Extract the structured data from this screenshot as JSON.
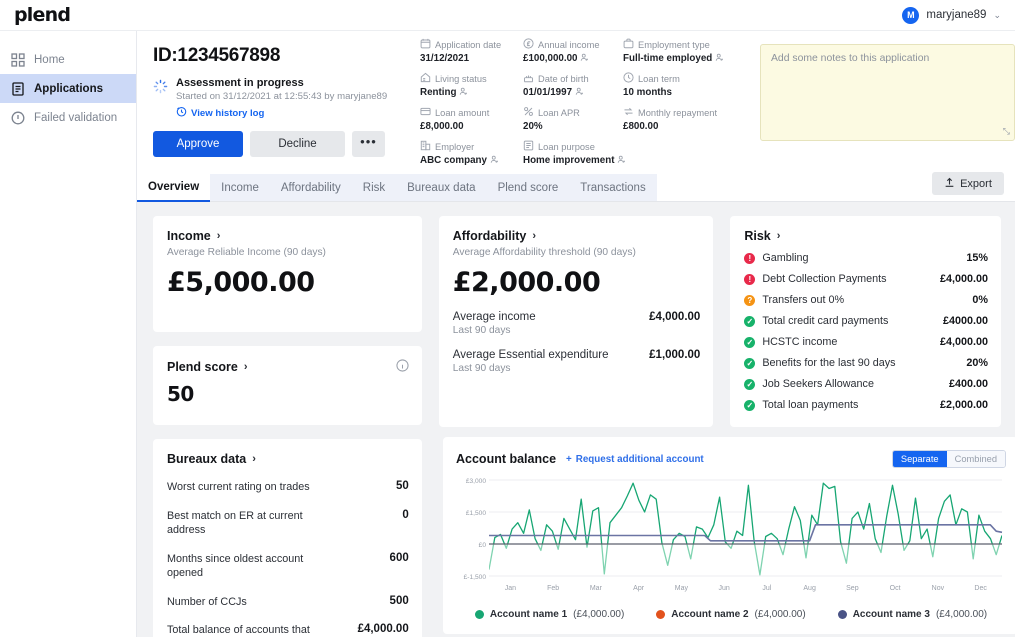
{
  "brand": {
    "logo": "plend",
    "accent": "#1259e0"
  },
  "topbar": {
    "user": "maryjane89",
    "avatar_initial": "M",
    "caret": "⌄"
  },
  "sidebar": {
    "items": [
      {
        "label": "Home",
        "icon": "grid-icon",
        "active": false
      },
      {
        "label": "Applications",
        "icon": "document-icon",
        "active": true
      },
      {
        "label": "Failed validation",
        "icon": "alert-circle-icon",
        "active": false
      }
    ]
  },
  "header": {
    "application_id": "ID:1234567898",
    "status_title": "Assessment in progress",
    "status_subtitle": "Started on 31/12/2021 at 12:55:43 by maryjane89",
    "history_link": "View history log",
    "buttons": {
      "approve": "Approve",
      "decline": "Decline",
      "more": "•••"
    }
  },
  "details": [
    {
      "label": "Application date",
      "value": "31/12/2021",
      "icon": "calendar-icon",
      "person": false
    },
    {
      "label": "Annual income",
      "value": "£100,000.00",
      "icon": "pound-circle-icon",
      "person": true
    },
    {
      "label": "Employment type",
      "value": "Full-time employed",
      "icon": "briefcase-icon",
      "person": true
    },
    {
      "label": "Living status",
      "value": "Renting",
      "icon": "home-icon",
      "person": true
    },
    {
      "label": "Date of birth",
      "value": "01/01/1997",
      "icon": "cake-icon",
      "person": true
    },
    {
      "label": "Loan term",
      "value": "10 months",
      "icon": "clock-icon",
      "person": false
    },
    {
      "label": "Loan amount",
      "value": "£8,000.00",
      "icon": "card-icon",
      "person": false
    },
    {
      "label": "Loan APR",
      "value": "20%",
      "icon": "percent-icon",
      "person": false
    },
    {
      "label": "Monthly repayment",
      "value": "£800.00",
      "icon": "repeat-icon",
      "person": false
    },
    {
      "label": "Employer",
      "value": "ABC company",
      "icon": "building-icon",
      "person": true
    },
    {
      "label": "Loan purpose",
      "value": "Home improvement",
      "icon": "list-icon",
      "person": true
    }
  ],
  "notes": {
    "placeholder": "Add some notes to this application",
    "value": "",
    "resize_icon": "resize-handle-icon"
  },
  "tabs": [
    {
      "label": "Overview",
      "active": true
    },
    {
      "label": "Income",
      "active": false
    },
    {
      "label": "Affordability",
      "active": false
    },
    {
      "label": "Risk",
      "active": false
    },
    {
      "label": "Bureaux data",
      "active": false
    },
    {
      "label": "Plend score",
      "active": false
    },
    {
      "label": "Transactions",
      "active": false
    }
  ],
  "export_button": {
    "label": "Export",
    "icon": "upload-icon"
  },
  "income_card": {
    "title": "Income",
    "subtitle": "Average Reliable Income (90 days)",
    "value": "£5,000.00"
  },
  "plend_score_card": {
    "title": "Plend score",
    "value": "50",
    "info_icon": "info-icon"
  },
  "affordability_card": {
    "title": "Affordability",
    "subtitle": "Average Affordability threshold (90 days)",
    "value": "£2,000.00",
    "rows": [
      {
        "label": "Average income",
        "sub": "Last 90 days",
        "value": "£4,000.00"
      },
      {
        "label": "Average Essential expenditure",
        "sub": "Last 90 days",
        "value": "£1,000.00"
      }
    ]
  },
  "risk_card": {
    "title": "Risk",
    "rows": [
      {
        "label": "Gambling",
        "value": "15%",
        "status": "bad",
        "color": "#e8294a"
      },
      {
        "label": "Debt Collection Payments",
        "value": "£4,000.00",
        "status": "bad",
        "color": "#e8294a"
      },
      {
        "label": "Transfers out 0%",
        "value": "0%",
        "status": "warn",
        "color": "#f59314"
      },
      {
        "label": "Total credit card payments",
        "value": "£4000.00",
        "status": "good",
        "color": "#17b26a"
      },
      {
        "label": "HCSTC income",
        "value": "£4,000.00",
        "status": "good",
        "color": "#17b26a"
      },
      {
        "label": "Benefits for the last 90 days",
        "value": "20%",
        "status": "good",
        "color": "#17b26a"
      },
      {
        "label": "Job Seekers Allowance",
        "value": "£400.00",
        "status": "good",
        "color": "#17b26a"
      },
      {
        "label": "Total loan payments",
        "value": "£2,000.00",
        "status": "good",
        "color": "#17b26a"
      }
    ]
  },
  "bureaux_card": {
    "title": "Bureaux data",
    "rows": [
      {
        "label": "Worst current rating on trades",
        "value": "50"
      },
      {
        "label": "Best match on ER at current address",
        "value": "0"
      },
      {
        "label": "Months since oldest account opened",
        "value": "600"
      },
      {
        "label": "Number of CCJs",
        "value": "500"
      },
      {
        "label": "Total balance of accounts that",
        "value": "£4,000.00"
      }
    ]
  },
  "account_balance": {
    "title": "Account balance",
    "request_link": "Request additional account",
    "toggle": {
      "selected": "Separate",
      "other": "Combined"
    },
    "legend": [
      {
        "name": "Account name 1",
        "amount": "(£4,000.00)",
        "color": "#17a673"
      },
      {
        "name": "Account name 2",
        "amount": "(£4,000.00)",
        "color": "#e2521d"
      },
      {
        "name": "Account name 3",
        "amount": "(£4,000.00)",
        "color": "#4a5386"
      }
    ]
  },
  "chart_data": {
    "type": "line",
    "title": "Account balance",
    "xlabel": "",
    "ylabel": "",
    "ylim": [
      -1500,
      3000
    ],
    "yticks": [
      "£3,000",
      "£1,500",
      "£0",
      "£-1,500"
    ],
    "ytick_values": [
      3000,
      1500,
      0,
      -1500
    ],
    "categories": [
      "Jan",
      "Feb",
      "Mar",
      "Apr",
      "May",
      "Jun",
      "Jul",
      "Aug",
      "Sep",
      "Oct",
      "Nov",
      "Dec"
    ],
    "grid": true,
    "legend_position": "bottom",
    "series": [
      {
        "name": "Account name 1",
        "color": "#17a673",
        "amount": "£4,000.00",
        "values": [
          -1200,
          300,
          450,
          -200,
          700,
          1000,
          500,
          1600,
          250,
          -300,
          900,
          600,
          -250,
          1200,
          700,
          200,
          2100,
          -150,
          1550,
          1700,
          -1400,
          1000,
          1350,
          1700,
          2250,
          2850,
          2050,
          1500,
          2300,
          2100,
          50,
          -1000,
          200,
          500,
          350,
          -700,
          800,
          700,
          300,
          900,
          2200,
          100,
          -200,
          600,
          400,
          2750,
          150,
          -1450,
          350,
          500,
          250,
          -500,
          700,
          1750,
          1100,
          -650,
          1350,
          900,
          2850,
          2600,
          2700,
          100,
          -900,
          1200,
          1500,
          700,
          1900,
          250,
          -400,
          1300,
          2750,
          1400,
          -300,
          150,
          2150,
          250,
          700,
          -600,
          1200,
          2000,
          2300,
          900,
          1650,
          1500,
          -700,
          1350,
          600,
          250,
          -500,
          400
        ]
      },
      {
        "name": "Account name 2",
        "color": "#e2521d",
        "amount": "£4,000.00",
        "values": [
          0,
          0,
          0,
          0,
          0,
          0,
          0,
          0,
          0,
          0,
          0,
          0
        ]
      },
      {
        "name": "Account name 3",
        "color": "#4a5386",
        "amount": "£4,000.00",
        "values": [
          400,
          400,
          400,
          400,
          400,
          400,
          400,
          400,
          400,
          400,
          400,
          400,
          400,
          400,
          400,
          400,
          400,
          400,
          400,
          400,
          400,
          400,
          400,
          400,
          400,
          400,
          400,
          400,
          400,
          400,
          400,
          400,
          400,
          400,
          400,
          400,
          400,
          400,
          150,
          150,
          150,
          150,
          150,
          150,
          150,
          150,
          150,
          150,
          150,
          150,
          150,
          150,
          150,
          150,
          150,
          150,
          900,
          900,
          900,
          900,
          900,
          900,
          900,
          900,
          900,
          900,
          900,
          900,
          900,
          900,
          900,
          900,
          900,
          900,
          900,
          900,
          900,
          900,
          900,
          900,
          900,
          900,
          900,
          900,
          900,
          900,
          900,
          600,
          550
        ]
      }
    ]
  }
}
